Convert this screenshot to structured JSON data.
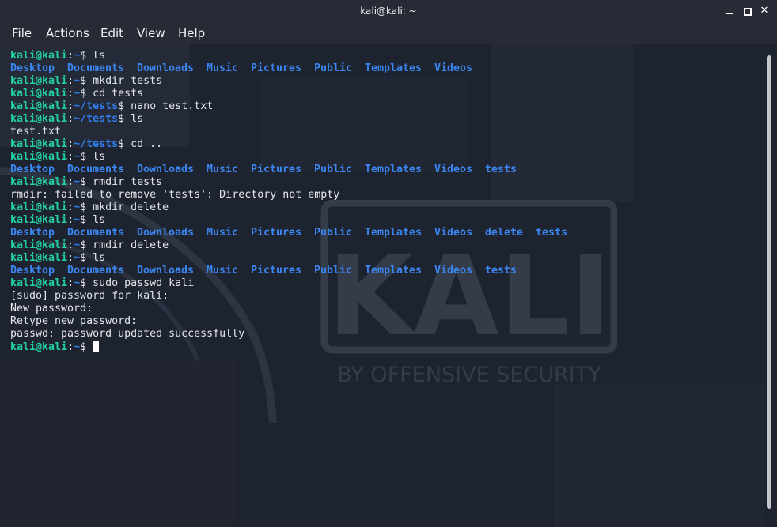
{
  "window": {
    "title": "kali@kali: ~",
    "minimize_label": "_",
    "maximize_label": "□",
    "close_label": "✕"
  },
  "menubar": {
    "items": [
      "File",
      "Actions",
      "Edit",
      "View",
      "Help"
    ]
  },
  "background": {
    "logo_text": "KALI",
    "logo_subtext": "BY OFFENSIVE SECURITY"
  },
  "prompt": {
    "user": "kali@kali",
    "sep": ":",
    "symbol": "$"
  },
  "terminal_lines": [
    {
      "type": "prompt",
      "path": "~",
      "cmd": " ls"
    },
    {
      "type": "dirs",
      "items": [
        "Desktop",
        "Documents",
        "Downloads",
        "Music",
        "Pictures",
        "Public",
        "Templates",
        "Videos"
      ]
    },
    {
      "type": "prompt",
      "path": "~",
      "cmd": " mkdir tests"
    },
    {
      "type": "prompt",
      "path": "~",
      "cmd": " cd tests"
    },
    {
      "type": "prompt",
      "path": "~/tests",
      "cmd": " nano test.txt"
    },
    {
      "type": "prompt",
      "path": "~/tests",
      "cmd": " ls"
    },
    {
      "type": "text",
      "text": "test.txt"
    },
    {
      "type": "prompt",
      "path": "~/tests",
      "cmd": " cd .."
    },
    {
      "type": "prompt",
      "path": "~",
      "cmd": " ls"
    },
    {
      "type": "dirs",
      "items": [
        "Desktop",
        "Documents",
        "Downloads",
        "Music",
        "Pictures",
        "Public",
        "Templates",
        "Videos",
        "tests"
      ]
    },
    {
      "type": "prompt",
      "path": "~",
      "cmd": " rmdir tests"
    },
    {
      "type": "text",
      "text": "rmdir: failed to remove 'tests': Directory not empty"
    },
    {
      "type": "prompt",
      "path": "~",
      "cmd": " mkdir delete"
    },
    {
      "type": "prompt",
      "path": "~",
      "cmd": " ls"
    },
    {
      "type": "dirs",
      "items": [
        "Desktop",
        "Documents",
        "Downloads",
        "Music",
        "Pictures",
        "Public",
        "Templates",
        "Videos",
        "delete",
        "tests"
      ]
    },
    {
      "type": "prompt",
      "path": "~",
      "cmd": " rmdir delete"
    },
    {
      "type": "prompt",
      "path": "~",
      "cmd": " ls"
    },
    {
      "type": "dirs",
      "items": [
        "Desktop",
        "Documents",
        "Downloads",
        "Music",
        "Pictures",
        "Public",
        "Templates",
        "Videos",
        "tests"
      ]
    },
    {
      "type": "prompt",
      "path": "~",
      "cmd": " sudo passwd kali"
    },
    {
      "type": "text",
      "text": "[sudo] password for kali:"
    },
    {
      "type": "text",
      "text": "New password:"
    },
    {
      "type": "text",
      "text": "Retype new password:"
    },
    {
      "type": "text",
      "text": "passwd: password updated successfully"
    },
    {
      "type": "prompt",
      "path": "~",
      "cmd": " ",
      "cursor": true
    }
  ],
  "colors": {
    "prompt_user": "#22d1a3",
    "prompt_path": "#2f7ff0",
    "directory": "#3b86f0",
    "text": "#e3e6ea",
    "background": "#1e2330"
  }
}
